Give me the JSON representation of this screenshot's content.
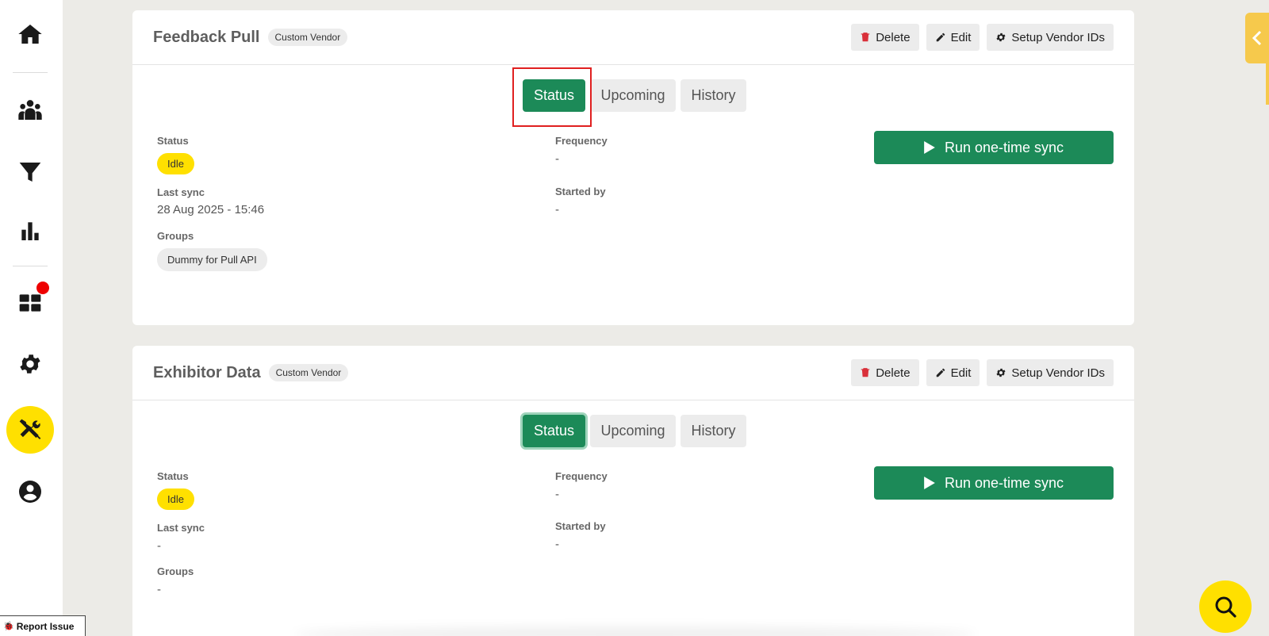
{
  "sidebar": {
    "items": [
      {
        "name": "home",
        "icon": "home-icon"
      },
      {
        "name": "people",
        "icon": "people-icon"
      },
      {
        "name": "filter",
        "icon": "filter-icon"
      },
      {
        "name": "analytics",
        "icon": "bar-chart-icon"
      },
      {
        "name": "dashboard",
        "icon": "dashboard-icon",
        "has_notification": true
      },
      {
        "name": "settings",
        "icon": "gear-icon"
      },
      {
        "name": "tools",
        "icon": "tools-icon",
        "active": true
      },
      {
        "name": "account",
        "icon": "account-icon"
      }
    ]
  },
  "report_issue": {
    "label": "Report Issue"
  },
  "actions": {
    "delete": "Delete",
    "edit": "Edit",
    "setup": "Setup Vendor IDs",
    "run": "Run one-time sync"
  },
  "tabs": [
    "Status",
    "Upcoming",
    "History"
  ],
  "labels": {
    "status": "Status",
    "last_sync": "Last sync",
    "groups": "Groups",
    "frequency": "Frequency",
    "started_by": "Started by"
  },
  "cards": [
    {
      "title": "Feedback Pull",
      "badge": "Custom Vendor",
      "status": "Idle",
      "last_sync": "28 Aug 2025 - 15:46",
      "group": "Dummy for Pull API",
      "frequency": "-",
      "started_by": "-"
    },
    {
      "title": "Exhibitor Data",
      "badge": "Custom Vendor",
      "status": "Idle",
      "last_sync": "-",
      "groups": "-",
      "frequency": "-",
      "started_by": "-"
    }
  ],
  "colors": {
    "accent_green": "#1c8a58",
    "accent_yellow": "#ffe000",
    "notification_red": "#ee0000",
    "highlight_red": "#e02020"
  }
}
